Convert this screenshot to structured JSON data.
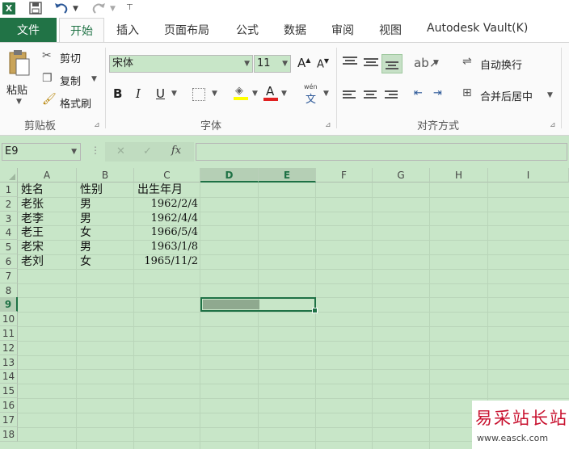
{
  "app": {
    "logo_text": "X"
  },
  "tabs": [
    "文件",
    "开始",
    "插入",
    "页面布局",
    "公式",
    "数据",
    "审阅",
    "视图",
    "Autodesk Vault(K)"
  ],
  "ribbon": {
    "clipboard": {
      "paste_label": "粘贴",
      "cut_label": "剪切",
      "copy_label": "复制",
      "format_painter_label": "格式刷",
      "group_label": "剪贴板"
    },
    "font": {
      "font_name": "宋体",
      "font_size": "11",
      "bold": "B",
      "italic": "I",
      "underline": "U",
      "font_color_icon": "A",
      "pinyin_icon": "文",
      "pinyin_top": "wén",
      "group_label": "字体"
    },
    "alignment": {
      "wrap_text_label": "自动换行",
      "merge_center_label": "合并后居中",
      "group_label": "对齐方式"
    }
  },
  "formula_bar": {
    "name_box": "E9",
    "cancel_icon": "✕",
    "enter_icon": "✓",
    "fx_label": "fx",
    "formula": ""
  },
  "sheet": {
    "columns": [
      "A",
      "B",
      "C",
      "D",
      "E",
      "F",
      "G",
      "H",
      "I"
    ],
    "rows": [
      "1",
      "2",
      "3",
      "4",
      "5",
      "6",
      "7",
      "8",
      "9",
      "10",
      "11",
      "12",
      "13",
      "14",
      "15",
      "16",
      "17",
      "18"
    ],
    "data": [
      [
        "姓名",
        "性别",
        "出生年月"
      ],
      [
        "老张",
        "男",
        "1962/2/4"
      ],
      [
        "老李",
        "男",
        "1962/4/4"
      ],
      [
        "老王",
        "女",
        "1966/5/4"
      ],
      [
        "老宋",
        "男",
        "1963/1/8"
      ],
      [
        "老刘",
        "女",
        "1965/11/2"
      ]
    ],
    "selected_cell": "E9"
  },
  "watermark": {
    "title": "易采站长站",
    "url": "www.easck.com"
  },
  "colors": {
    "excel_green": "#217346",
    "sheet_bg": "#c8e6c8",
    "selection": "#1e7145"
  }
}
